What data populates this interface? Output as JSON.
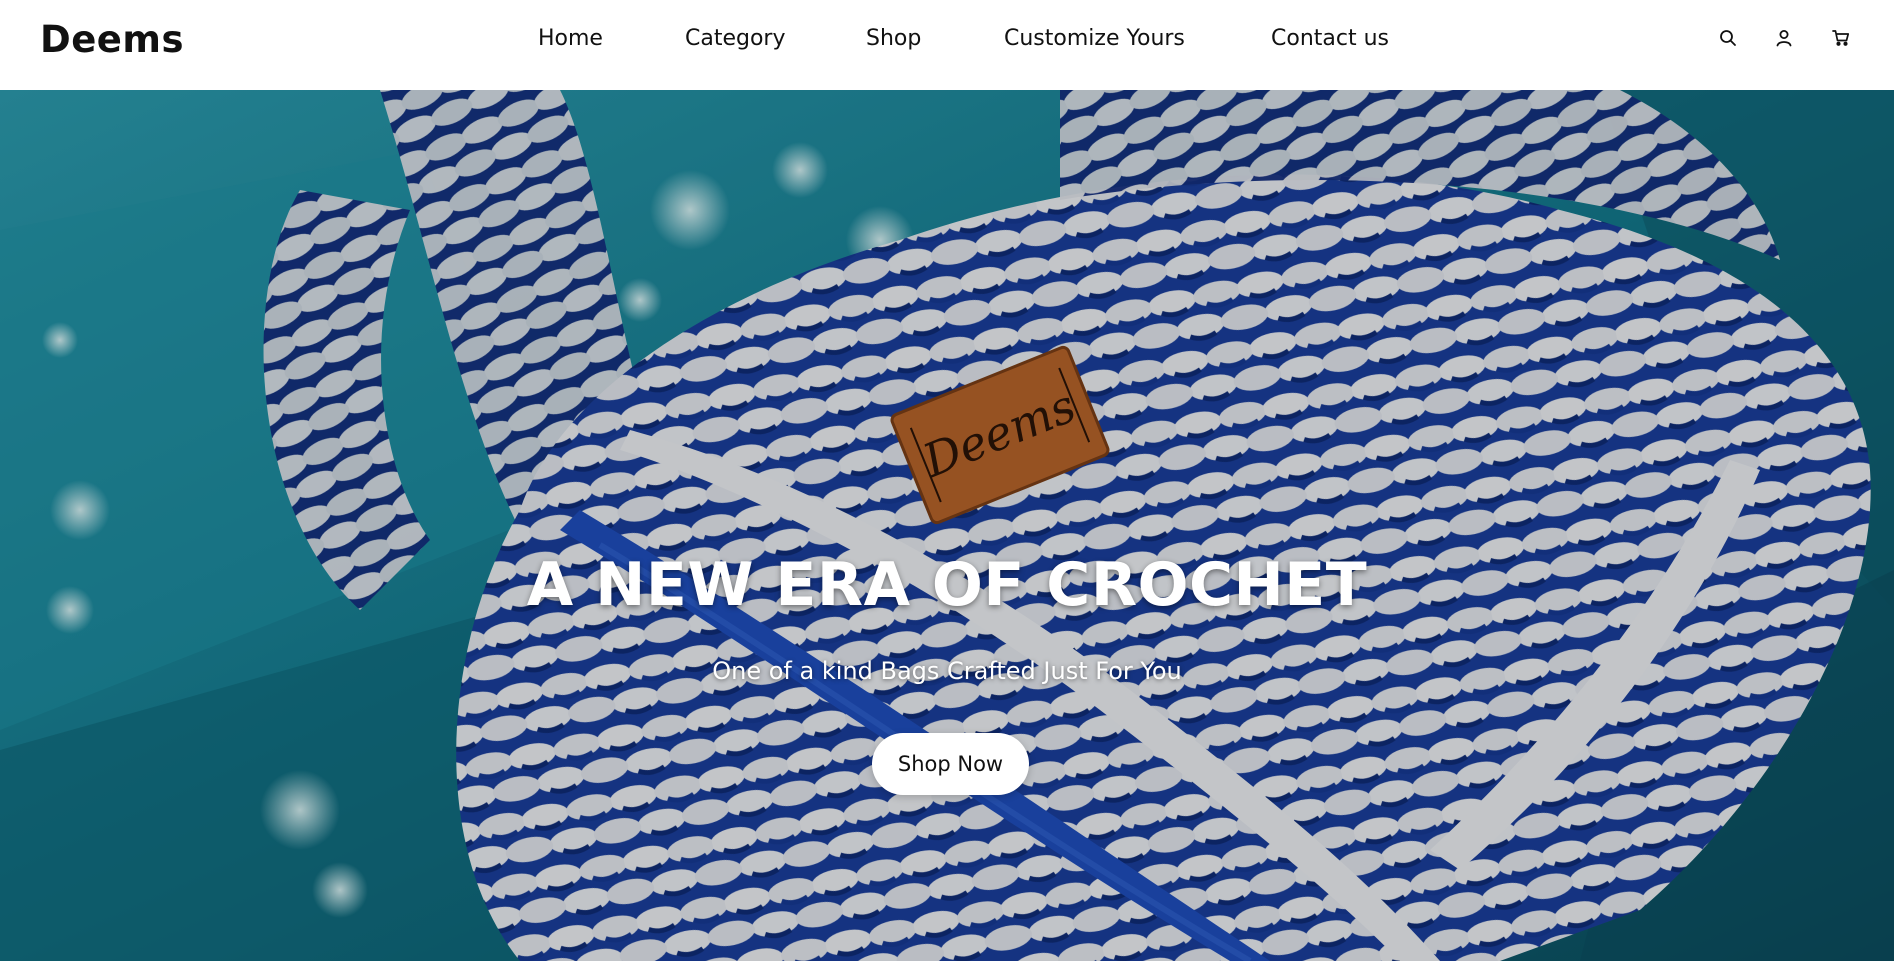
{
  "brand": {
    "name": "Deems"
  },
  "nav": {
    "items": [
      {
        "label": "Home"
      },
      {
        "label": "Category"
      },
      {
        "label": "Shop"
      },
      {
        "label": "Customize Yours"
      },
      {
        "label": "Contact us"
      }
    ],
    "icons": [
      "search-icon",
      "user-icon",
      "cart-icon"
    ]
  },
  "hero": {
    "title": "A NEW ERA OF CROCHET",
    "subtitle": "One of a kind Bags Crafted Just For You",
    "cta_label": "Shop Now",
    "image": "crochet-bag-photo",
    "tag_logo_text": "Deems"
  },
  "colors": {
    "water": "#1d8ea3",
    "water_dark": "#0e5d6e",
    "yarn_blue": "#1c43a8",
    "yarn_white": "#e9ecf1",
    "leather_tag": "#b8642a"
  }
}
